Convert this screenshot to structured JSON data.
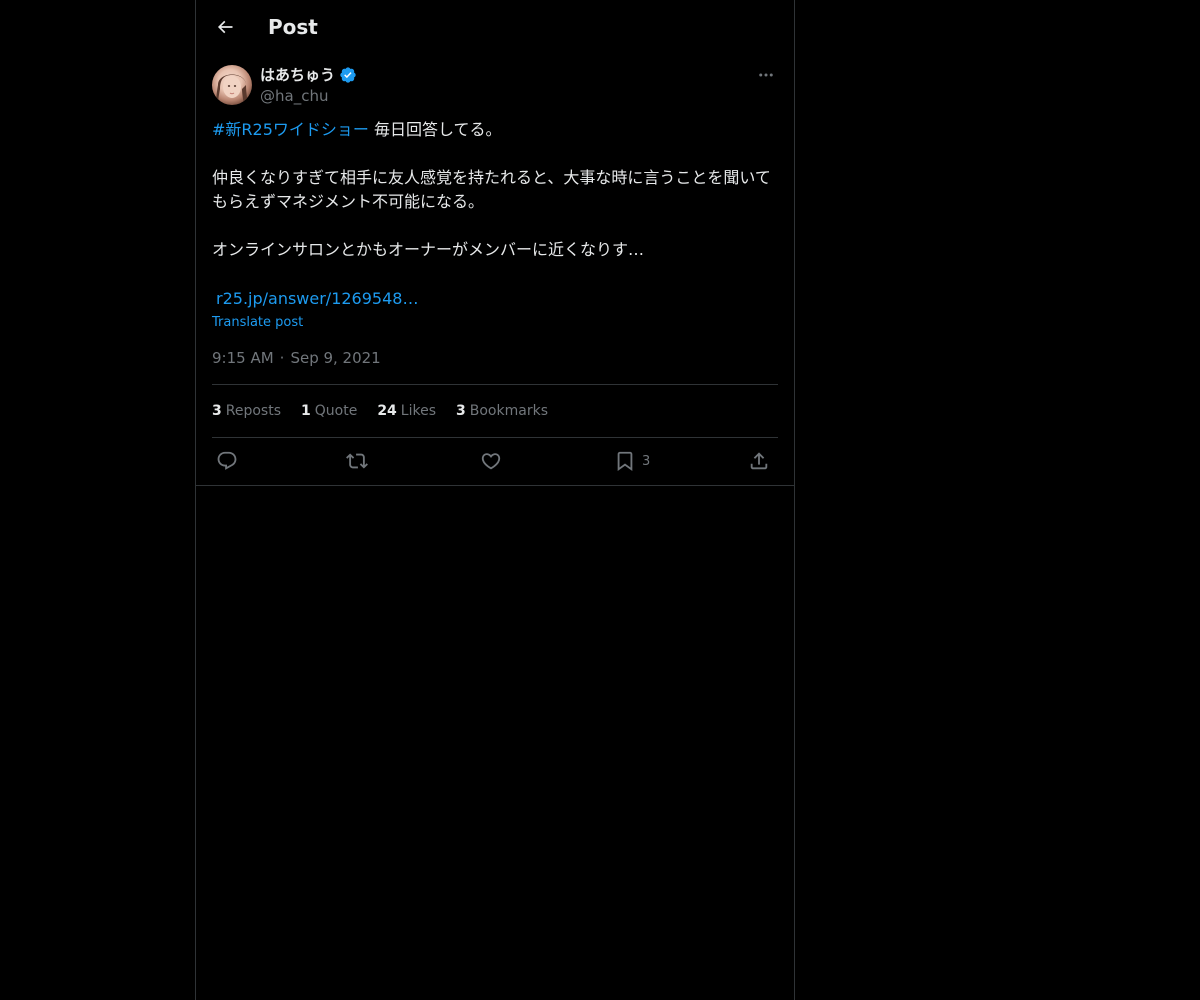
{
  "header": {
    "title": "Post"
  },
  "author": {
    "name": "はあちゅう",
    "handle": "@ha_chu",
    "verified": true
  },
  "post": {
    "hashtag": "#新R25ワイドショー",
    "line1_rest": " 毎日回答してる。",
    "paragraph2": "仲良くなりすぎて相手に友人感覚を持たれると、大事な時に言うことを聞いてもらえずマネジメント不可能になる。",
    "paragraph3": "オンラインサロンとかもオーナーがメンバーに近くなりす…",
    "link": "r25.jp/answer/1269548…",
    "translate_label": "Translate post",
    "time": "9:15 AM",
    "separator": "·",
    "date": "Sep 9, 2021"
  },
  "stats": {
    "reposts_count": "3",
    "reposts_label": "Reposts",
    "quotes_count": "1",
    "quotes_label": "Quote",
    "likes_count": "24",
    "likes_label": "Likes",
    "bookmarks_count": "3",
    "bookmarks_label": "Bookmarks"
  },
  "actions": {
    "reply": "reply-icon",
    "repost": "repost-icon",
    "like": "heart-icon",
    "bookmark": "bookmark-icon",
    "bookmark_count": "3",
    "share": "share-icon"
  },
  "colors": {
    "background": "#000000",
    "text": "#e7e9ea",
    "muted": "#71767b",
    "accent": "#1d9bf0",
    "border": "#2f3336"
  }
}
